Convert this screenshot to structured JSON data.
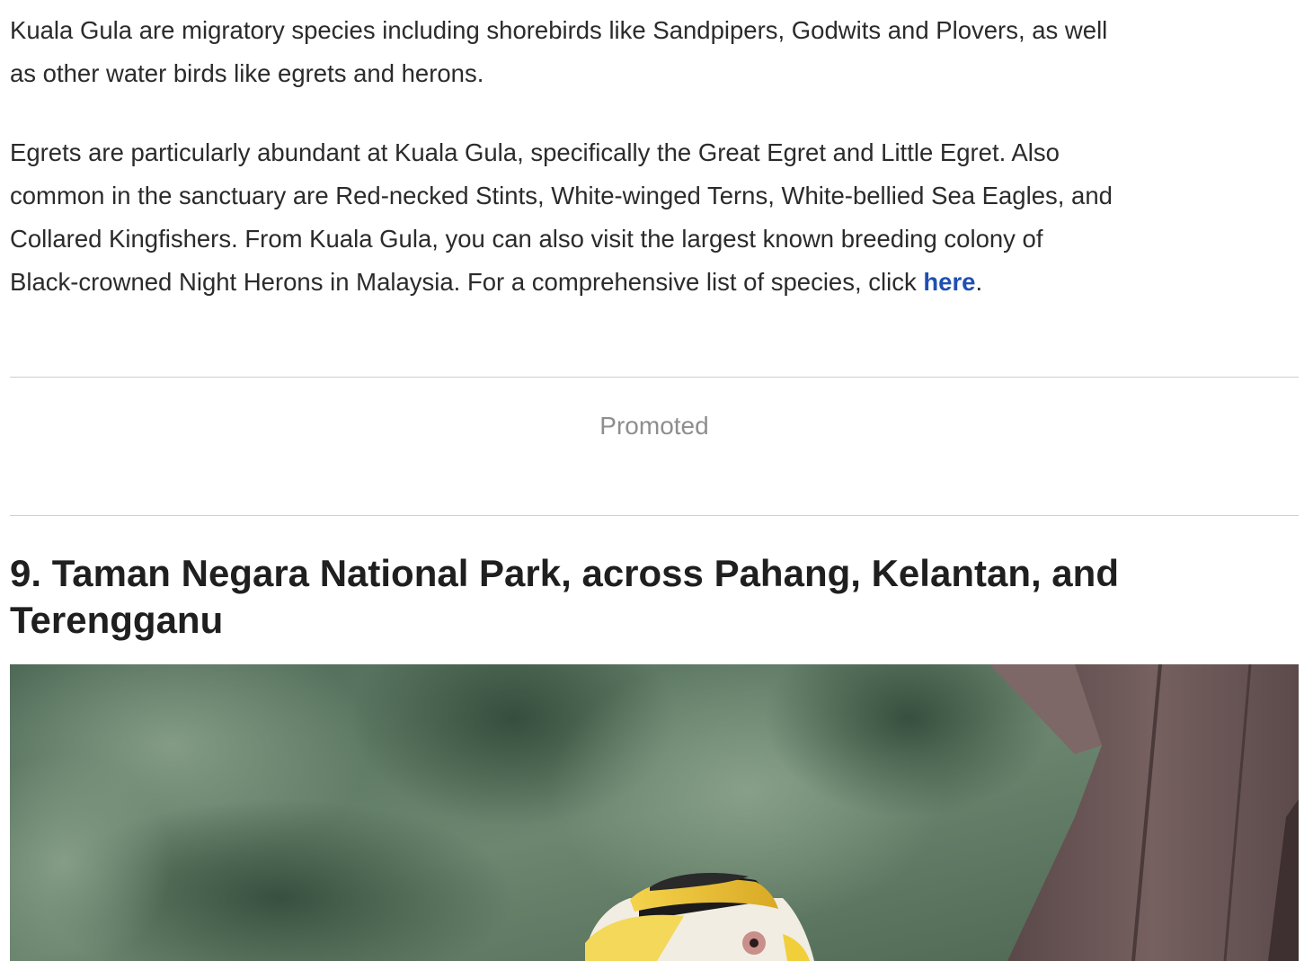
{
  "article": {
    "paragraph1": {
      "line1": "Kuala Gula are migratory species including shorebirds like Sandpipers, Godwits and Plovers, as well",
      "line2": "as other water birds like egrets and herons."
    },
    "paragraph2": {
      "line1": "Egrets are particularly abundant at Kuala Gula, specifically the Great Egret and Little Egret. Also",
      "line2": "common in the sanctuary are Red-necked Stints, White-winged Terns, White-bellied Sea Eagles, and",
      "line3": "Collared Kingfishers. From Kuala Gula, you can also visit the largest known breeding colony of",
      "line4_text": "Black-crowned Night Herons in Malaysia. For a comprehensive list of species, click ",
      "link_label": "here",
      "line4_end": "."
    },
    "promoted_label": "Promoted",
    "section_heading": {
      "line1": "9. Taman Negara National Park, across Pahang, Kelantan, and",
      "line2": "Terengganu"
    }
  },
  "photo": {
    "subject": "great-hornbill",
    "colors": {
      "background": "#5f7a66",
      "foliage": "#3d5a45",
      "wood": "#6b5656",
      "casque": "#e8c23a",
      "bill": "#f2d24a",
      "head": "#1a1a1a",
      "eye": "#c98f8a"
    }
  },
  "colors": {
    "text": "#2b2b2b",
    "link": "#1f4fb2",
    "muted": "#8e8e8e",
    "divider": "#cfcfcf",
    "heading": "#1f1f1f"
  }
}
